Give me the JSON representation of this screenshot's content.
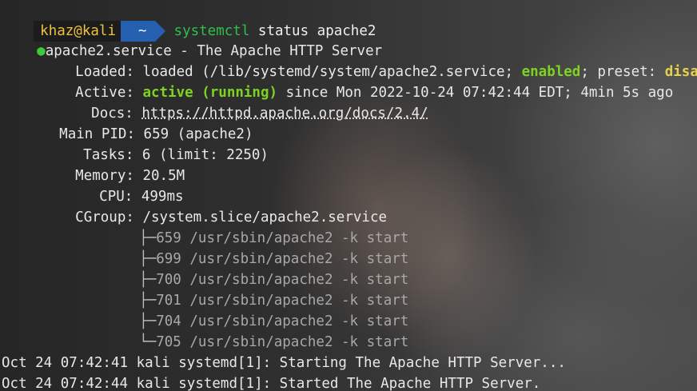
{
  "prompt": {
    "user_host": "khaz@kali",
    "cwd": "~",
    "command": "systemctl",
    "args": "status apache2"
  },
  "service": {
    "dot": "●",
    "header": "apache2.service - The Apache HTTP Server",
    "loaded_key": "Loaded:",
    "loaded_prefix": "loaded (/lib/systemd/system/apache2.service; ",
    "loaded_state": "enabled",
    "loaded_mid": "; preset: ",
    "preset_state": "disabled",
    "loaded_suffix": ")",
    "active_key": "Active:",
    "active_state": "active (running)",
    "active_rest": " since Mon 2022-10-24 07:42:44 EDT; 4min 5s ago",
    "docs_key": "Docs:",
    "docs_url": "https://httpd.apache.org/docs/2.4/",
    "pid_key": "Main PID:",
    "pid_value": "659 (apache2)",
    "tasks_key": "Tasks:",
    "tasks_value": "6 (limit: 2250)",
    "memory_key": "Memory:",
    "memory_value": "20.5M",
    "cpu_key": "CPU:",
    "cpu_value": "499ms",
    "cgroup_key": "CGroup:",
    "cgroup_value": "/system.slice/apache2.service"
  },
  "processes": [
    {
      "branch": "├─",
      "text": "659 /usr/sbin/apache2 -k start"
    },
    {
      "branch": "├─",
      "text": "699 /usr/sbin/apache2 -k start"
    },
    {
      "branch": "├─",
      "text": "700 /usr/sbin/apache2 -k start"
    },
    {
      "branch": "├─",
      "text": "701 /usr/sbin/apache2 -k start"
    },
    {
      "branch": "├─",
      "text": "704 /usr/sbin/apache2 -k start"
    },
    {
      "branch": "└─",
      "text": "705 /usr/sbin/apache2 -k start"
    }
  ],
  "log": [
    "Oct 24 07:42:41 kali systemd[1]: Starting The Apache HTTP Server...",
    "Oct 24 07:42:44 kali systemd[1]: Started The Apache HTTP Server."
  ]
}
